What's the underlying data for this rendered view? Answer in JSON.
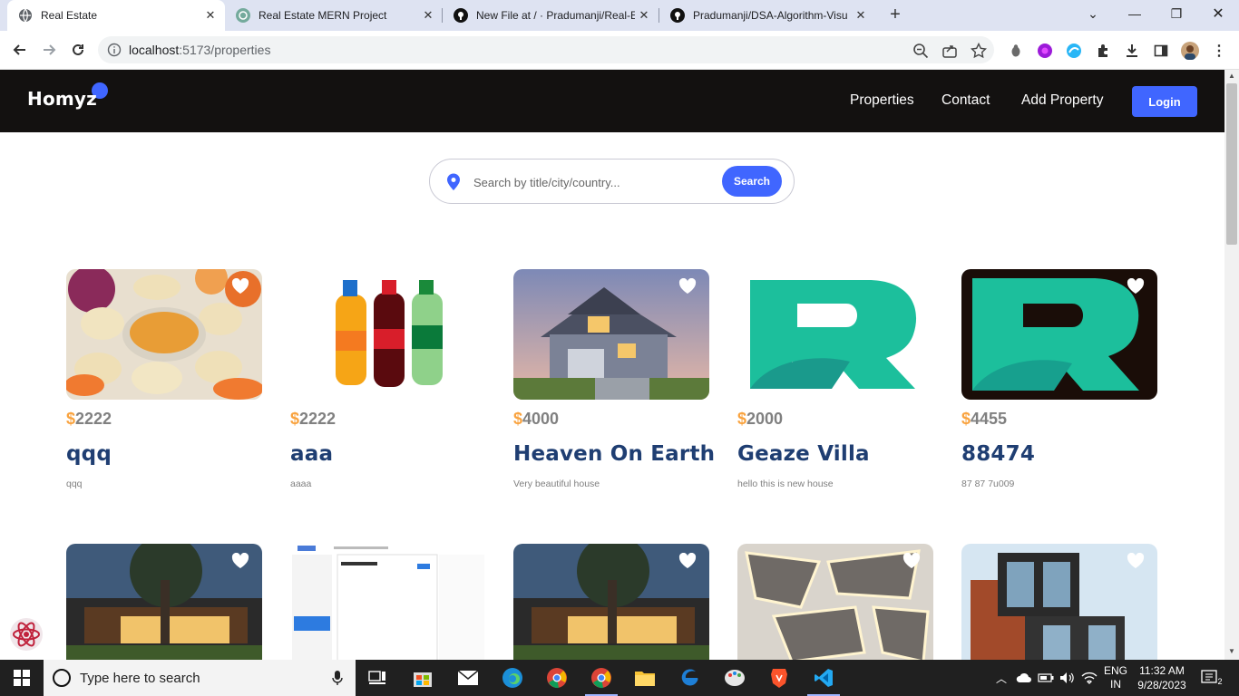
{
  "browser": {
    "tabs": [
      {
        "title": "Real Estate",
        "icon": "globe-icon",
        "active": true
      },
      {
        "title": "Real Estate MERN Project",
        "icon": "chatgpt-icon",
        "active": false
      },
      {
        "title": "New File at / · Pradumanji/Real-E",
        "icon": "github-icon",
        "active": false
      },
      {
        "title": "Pradumanji/DSA-Algorithm-Visu",
        "icon": "github-icon",
        "active": false
      }
    ],
    "url_host": "localhost",
    "url_rest": ":5173/properties"
  },
  "site": {
    "logo": "Homyz",
    "nav": [
      "Properties",
      "Contact",
      "Add Property"
    ],
    "login": "Login",
    "search_placeholder": "Search by title/city/country...",
    "search_button": "Search"
  },
  "properties": [
    {
      "price_symbol": "$",
      "price": "2222",
      "title": "qqq",
      "description": "qqq",
      "image": "momos"
    },
    {
      "price_symbol": "$",
      "price": "2222",
      "title": "aaa",
      "description": "aaaa",
      "image": "bottles"
    },
    {
      "price_symbol": "$",
      "price": "4000",
      "title": "Heaven On Earth",
      "description": "Very beautiful house",
      "image": "house"
    },
    {
      "price_symbol": "$",
      "price": "2000",
      "title": "Geaze Villa",
      "description": "hello this is new house",
      "image": "logo-r-white"
    },
    {
      "price_symbol": "$",
      "price": "4455",
      "title": "88474",
      "description": "87 87 7u009",
      "image": "logo-r-dark"
    },
    {
      "image": "modern-house"
    },
    {
      "image": "screenshot"
    },
    {
      "image": "modern-house"
    },
    {
      "image": "ceiling"
    },
    {
      "image": "building"
    }
  ],
  "taskbar": {
    "search_text": "Type here to search",
    "lang_top": "ENG",
    "lang_bottom": "IN",
    "time": "11:32 AM",
    "date": "9/28/2023",
    "notifications": "2"
  },
  "colors": {
    "brand_blue": "#4066ff",
    "header_bg": "#131110",
    "title_navy": "#1f3e72",
    "price_orange": "#f9a33f"
  }
}
